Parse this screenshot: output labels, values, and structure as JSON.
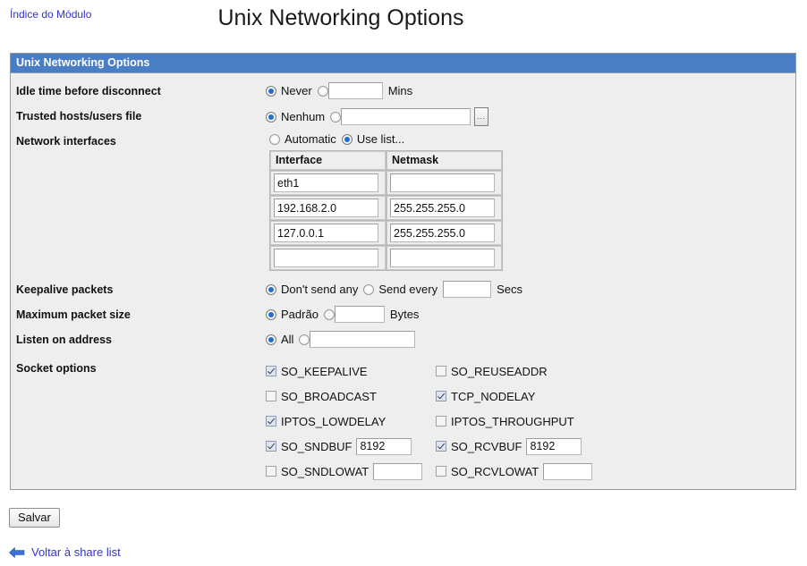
{
  "header": {
    "module_index_link": "Índice do Módulo",
    "page_title": "Unix Networking Options"
  },
  "panel": {
    "heading": "Unix Networking Options",
    "accent_color": "#4a7ec4"
  },
  "form": {
    "idle_time": {
      "label": "Idle time before disconnect",
      "option_never": "Never",
      "never_selected": true,
      "value": "",
      "unit": "Mins"
    },
    "trusted_hosts": {
      "label": "Trusted hosts/users file",
      "option_none": "Nenhum",
      "none_selected": true,
      "value": "",
      "browse_label": "..."
    },
    "network_interfaces": {
      "label": "Network interfaces",
      "option_automatic": "Automatic",
      "option_use_list": "Use list...",
      "selected": "use_list",
      "columns": [
        "Interface",
        "Netmask"
      ],
      "rows": [
        {
          "interface": "eth1",
          "netmask": ""
        },
        {
          "interface": "192.168.2.0",
          "netmask": "255.255.255.0"
        },
        {
          "interface": "127.0.0.1",
          "netmask": "255.255.255.0"
        },
        {
          "interface": "",
          "netmask": ""
        }
      ]
    },
    "keepalive": {
      "label": "Keepalive packets",
      "option_none": "Don't send any",
      "option_every": "Send every",
      "none_selected": true,
      "value": "",
      "unit": "Secs"
    },
    "max_packet": {
      "label": "Maximum packet size",
      "option_default": "Padrão",
      "default_selected": true,
      "value": "",
      "unit": "Bytes"
    },
    "listen_address": {
      "label": "Listen on address",
      "option_all": "All",
      "all_selected": true,
      "value": ""
    },
    "socket_options": {
      "label": "Socket options",
      "items": [
        {
          "name": "SO_KEEPALIVE",
          "checked": true,
          "has_input": false,
          "value": ""
        },
        {
          "name": "SO_REUSEADDR",
          "checked": false,
          "has_input": false,
          "value": ""
        },
        {
          "name": "SO_BROADCAST",
          "checked": false,
          "has_input": false,
          "value": ""
        },
        {
          "name": "TCP_NODELAY",
          "checked": true,
          "has_input": false,
          "value": ""
        },
        {
          "name": "IPTOS_LOWDELAY",
          "checked": true,
          "has_input": false,
          "value": ""
        },
        {
          "name": "IPTOS_THROUGHPUT",
          "checked": false,
          "has_input": false,
          "value": ""
        },
        {
          "name": "SO_SNDBUF",
          "checked": true,
          "has_input": true,
          "value": "8192"
        },
        {
          "name": "SO_RCVBUF",
          "checked": true,
          "has_input": true,
          "value": "8192"
        },
        {
          "name": "SO_SNDLOWAT",
          "checked": false,
          "has_input": true,
          "value": ""
        },
        {
          "name": "SO_RCVLOWAT",
          "checked": false,
          "has_input": true,
          "value": ""
        }
      ]
    }
  },
  "footer": {
    "save_label": "Salvar",
    "back_link": "Voltar à share list",
    "back_icon": "arrow-left-icon"
  }
}
